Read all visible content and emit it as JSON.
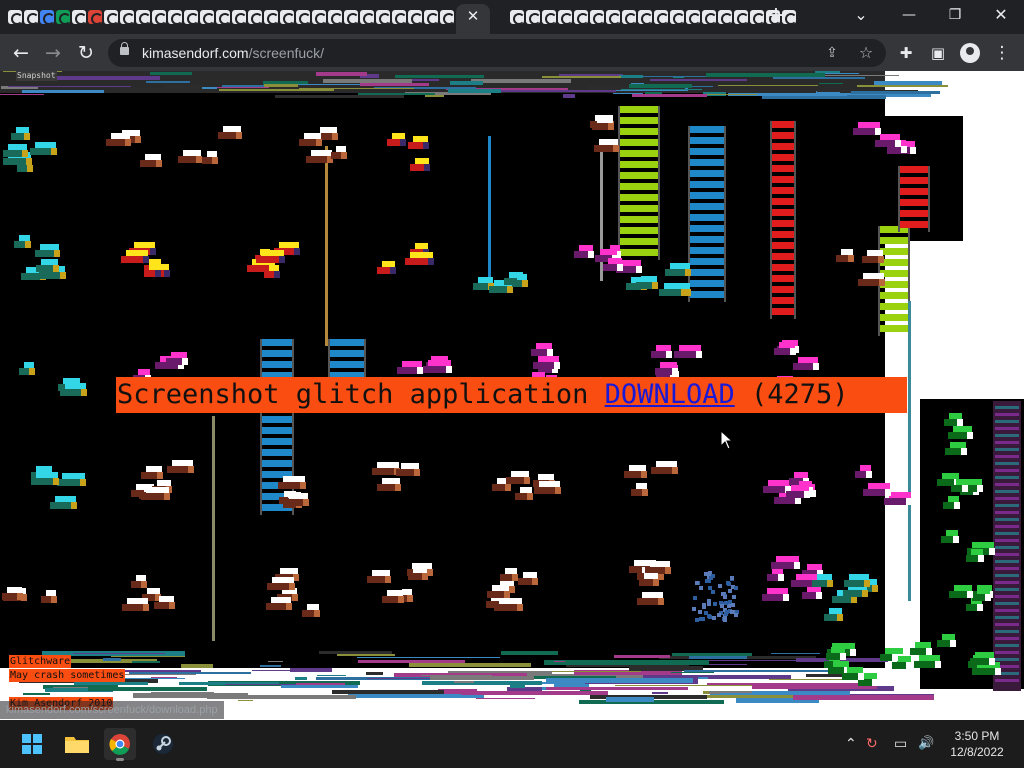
{
  "browser": {
    "tab_close": "✕",
    "new_tab": "+",
    "tab_search": "⌄",
    "window": {
      "minimize": "—",
      "maximize": "❐",
      "close": "✕"
    },
    "nav": {
      "back": "←",
      "forward": "→",
      "reload": "↻"
    },
    "url": {
      "domain": "kimasendorf.com",
      "path": "/screenfuck/"
    },
    "toolbar_icons": [
      "share-icon",
      "bookmark-star-icon",
      "extensions-icon",
      "side-panel-icon",
      "profile-icon",
      "menu-icon"
    ],
    "icons": {
      "share": "⇪",
      "star": "☆",
      "extensions": "✚",
      "side_panel": "▣",
      "menu": "⋮"
    }
  },
  "page": {
    "banner": {
      "prefix": "Screenshot glitch application ",
      "link_text": "DOWNLOAD",
      "suffix": " (4275)"
    },
    "labels": {
      "glitchware": "Glitchware",
      "crash_note": "May crash sometimes",
      "author": "Kim Asendorf 2010",
      "snapshot": "Snapshot"
    },
    "status_bar_url": "kimasendorf.com/screenfuck/download.php",
    "colors": {
      "banner_bg": "#fa4d12",
      "link": "#1a1ad6",
      "glitch_bg": "#000000"
    }
  },
  "taskbar": {
    "apps": [
      "start-icon",
      "file-explorer-icon",
      "chrome-icon",
      "steam-icon"
    ],
    "tray": {
      "chevron": "⌃",
      "sync": "↻",
      "display": "▭",
      "volume": "🔊"
    },
    "time": "3:50 PM",
    "date": "12/8/2022"
  }
}
